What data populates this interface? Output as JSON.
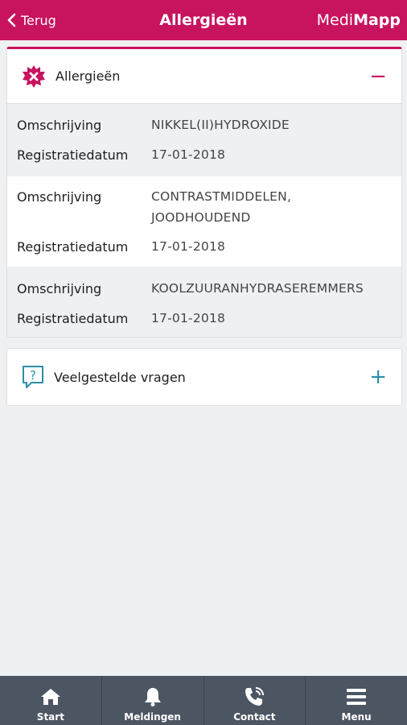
{
  "header": {
    "back_label": "Terug",
    "title": "Allergieën",
    "brand_part1": "Medi",
    "brand_part2": "Mapp",
    "color": "#c8135f"
  },
  "allergies": {
    "title": "Allergieën",
    "toggle": "−",
    "records": [
      {
        "label_desc": "Omschrijving",
        "desc": "NIKKEL(II)HYDROXIDE",
        "label_date": "Registratiedatum",
        "date": "17-01-2018"
      },
      {
        "label_desc": "Omschrijving",
        "desc_line1": "CONTRASTMIDDELEN,",
        "desc_line2": "JOODHOUDEND",
        "label_date": "Registratiedatum",
        "date": "17-01-2018"
      },
      {
        "label_desc": "Omschrijving",
        "desc": "KOOLZUURANHYDRASEREMMERS",
        "label_date": "Registratiedatum",
        "date": "17-01-2018"
      }
    ]
  },
  "faq": {
    "title": "Veelgestelde vragen",
    "toggle": "+"
  },
  "nav": {
    "items": [
      {
        "label": "Start",
        "icon": "home-icon"
      },
      {
        "label": "Meldingen",
        "icon": "bell-icon"
      },
      {
        "label": "Contact",
        "icon": "phone-icon"
      },
      {
        "label": "Menu",
        "icon": "menu-icon"
      }
    ]
  }
}
